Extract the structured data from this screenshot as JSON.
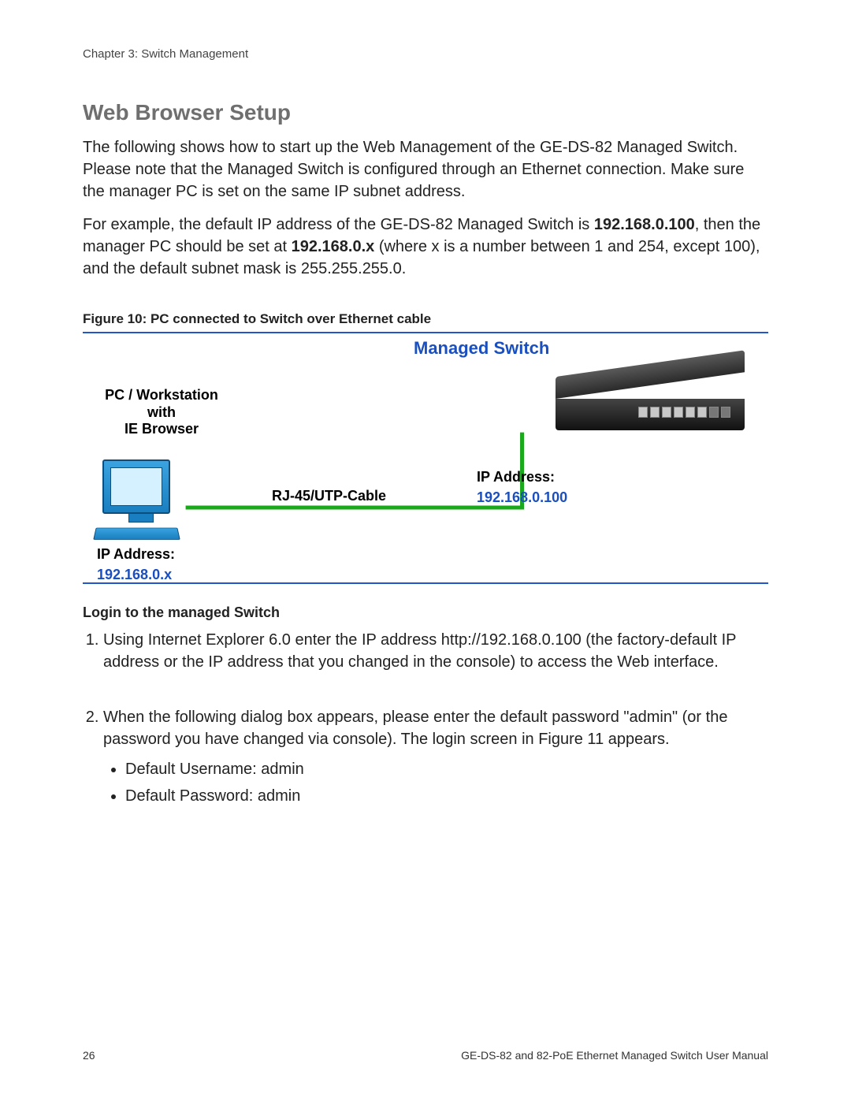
{
  "chapter_label": "Chapter 3: Switch Management",
  "section_title": "Web Browser Setup",
  "para1": "The following shows how to start up the Web Management of the GE-DS-82 Managed Switch. Please note that the Managed Switch is configured through an Ethernet connection. Make sure the manager PC is set on the same IP subnet address.",
  "para2_a": "For example, the default IP address of the GE-DS-82 Managed Switch is ",
  "para2_b": "192.168.0.100",
  "para2_c": ", then the manager PC should be set at ",
  "para2_d": "192.168.0.x",
  "para2_e": " (where x is a number between 1 and 254, except 100), and the default subnet mask is 255.255.255.0.",
  "figure_caption": "Figure 10: PC connected to Switch over Ethernet cable",
  "figure": {
    "managed_switch": "Managed Switch",
    "pc_label": "PC / Workstation\nwith\nIE Browser",
    "pc_ip_label": "IP Address:",
    "pc_ip_value": "192.168.0.x",
    "cable_label": "RJ-45/UTP-Cable",
    "switch_ip_label": "IP Address:",
    "switch_ip_value": "192.168.0.100"
  },
  "login_heading": "Login to the managed Switch",
  "step1_a": "Using Internet Explorer 6.0 enter the IP address ",
  "step1_b": "http://192.168.0.100",
  "step1_c": " (the factory-default IP address or the IP address that you changed in the console) to access the Web interface.",
  "step2": "When the following dialog box appears, please enter the default password \"admin\" (or the password you have changed via console). The login screen in Figure 11 appears.",
  "step2_user_a": "Default Username: ",
  "step2_user_b": "admin",
  "step2_pass_a": "Default Password: ",
  "step2_pass_b": "admin",
  "page_number": "26",
  "footer_right": "GE-DS-82 and 82-PoE Ethernet Managed Switch User Manual"
}
